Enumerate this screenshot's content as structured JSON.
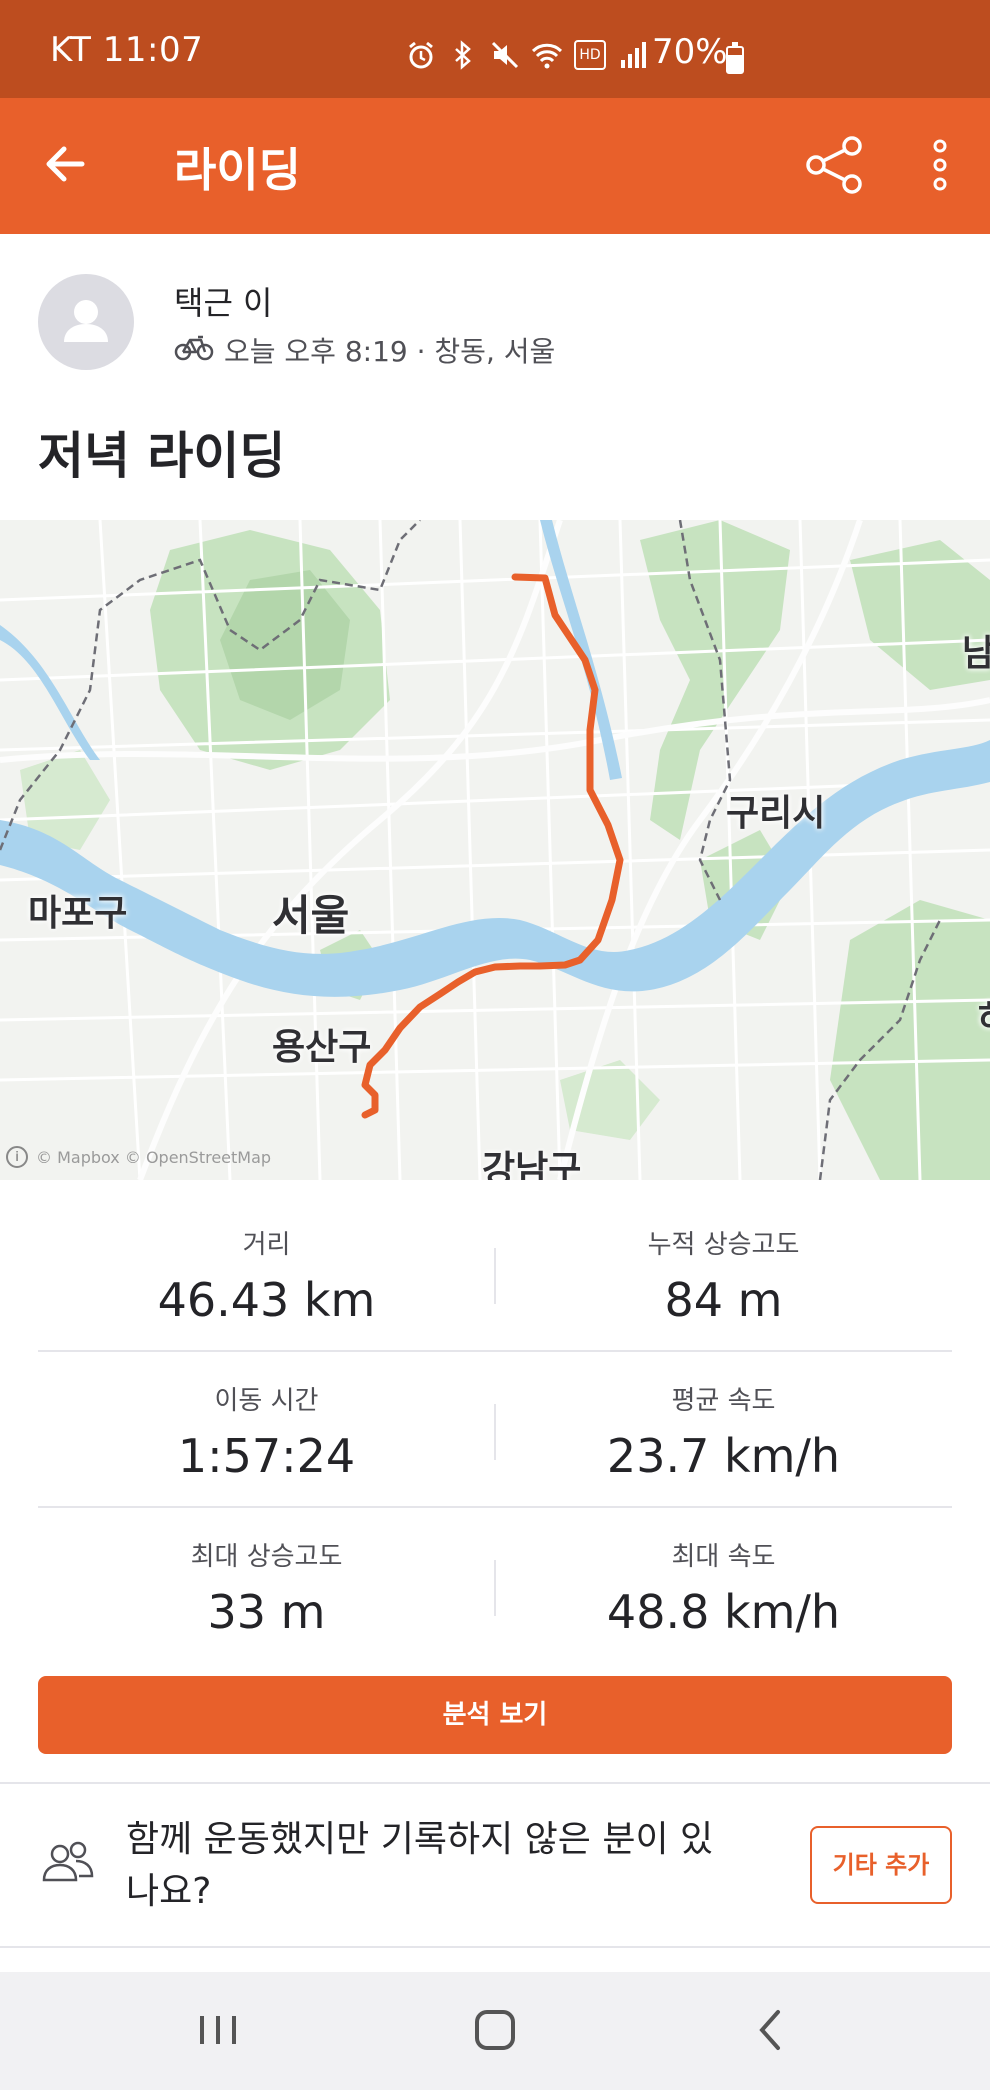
{
  "status_bar": {
    "carrier_time": "KT 11:07",
    "battery": "70%",
    "battery_level": 0.7,
    "icons": [
      "alarm-icon",
      "bluetooth-icon",
      "mute-icon",
      "wifi-icon",
      "hd-icon",
      "signal-icon",
      "battery-icon"
    ],
    "hd_label": "HD"
  },
  "app_bar": {
    "title": "라이딩",
    "icons": [
      "back-arrow-icon",
      "share-icon",
      "more-vertical-icon"
    ]
  },
  "activity": {
    "user_name": "택근 이",
    "meta": "오늘 오후 8:19 · 창동, 서울",
    "title": "저녁 라이딩",
    "type_icon": "bicycle-icon"
  },
  "map": {
    "labels": {
      "mapo": "마포구",
      "seoul": "서울",
      "yongsan": "용산구",
      "gangnam": "강남구",
      "guri": "구리시",
      "nam": "남",
      "right_edge": "하"
    },
    "attribution": "© Mapbox © OpenStreetMap",
    "route_color": "#e8602b",
    "river_color": "#a9d3ee",
    "park_color": "#c7e3c0"
  },
  "stats": [
    {
      "left": {
        "label": "거리",
        "value": "46.43 km"
      },
      "right": {
        "label": "누적 상승고도",
        "value": "84 m"
      }
    },
    {
      "left": {
        "label": "이동 시간",
        "value": "1:57:24"
      },
      "right": {
        "label": "평균 속도",
        "value": "23.7 km/h"
      }
    },
    {
      "left": {
        "label": "최대 상승고도",
        "value": "33 m"
      },
      "right": {
        "label": "최대 속도",
        "value": "48.8 km/h"
      }
    }
  ],
  "analysis_button": "분석 보기",
  "prompt": {
    "text": "함께 운동했지만 기록하지 않은 분이 있나요?",
    "button": "기타 추가",
    "icon": "group-icon"
  },
  "nav_bar": {
    "icons": [
      "recents-icon",
      "home-icon",
      "back-icon"
    ]
  },
  "colors": {
    "accent": "#e8602b",
    "status_bar": "#bd4d1f"
  }
}
